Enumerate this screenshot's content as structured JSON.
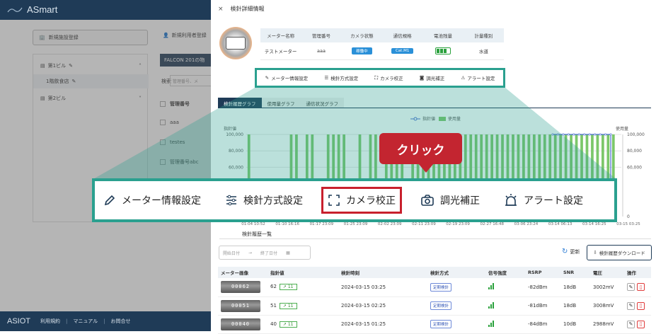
{
  "app": {
    "brand": "ASmart"
  },
  "bg": {
    "register_btn": "新規施設登録",
    "user_btn": "新規利用者登録",
    "tree": [
      {
        "label": "第1ビル"
      },
      {
        "label": "1階飲食店"
      },
      {
        "label": "第2ビル"
      }
    ],
    "facility_tab": "FALCON 201の物",
    "search_label": "検索",
    "search_placeholder": "管理番号、メ",
    "col_header": "管理番号",
    "rows": [
      "aaa",
      "testes",
      "管理番号abc"
    ]
  },
  "footer": {
    "logo": "ASIOT",
    "links": [
      "利用規約",
      "マニュアル",
      "お問合せ"
    ]
  },
  "panel": {
    "close": "×",
    "title": "検針詳細情報",
    "info_headers": [
      "メーター名称",
      "管理番号",
      "カメラ状態",
      "通信規格",
      "電池残量",
      "計量種別"
    ],
    "info_values": {
      "name": "テストメーター",
      "id": "aaa",
      "camera": "稼働中",
      "comm": "Cat.M1",
      "type": "水道"
    },
    "actions": [
      "メーター情報設定",
      "検針方式設定",
      "カメラ校正",
      "調光補正",
      "アラート設定"
    ],
    "tabs": [
      "検針履歴グラフ",
      "使用量グラフ",
      "通信状況グラフ"
    ],
    "history_title": "検針履歴一覧",
    "date_from": "開始日付",
    "date_to": "終了日付",
    "refresh": "更新",
    "download": "検針履歴ダウンロード",
    "table_headers": [
      "メーター画像",
      "指針値",
      "検針時刻",
      "検針方式",
      "信号強度",
      "RSRP",
      "SNR",
      "電圧",
      "操作"
    ],
    "table_rows": [
      {
        "img": "00062",
        "value": "62",
        "delta": "↗ 11",
        "time": "2024-03-15 03:25",
        "method": "定期検針",
        "rsrp": "-82dBm",
        "snr": "18dB",
        "volt": "3002mV"
      },
      {
        "img": "00051",
        "value": "51",
        "delta": "↗ 11",
        "time": "2024-03-15 02:25",
        "method": "定期検針",
        "rsrp": "-81dBm",
        "snr": "18dB",
        "volt": "3008mV"
      },
      {
        "img": "00040",
        "value": "40",
        "delta": "↗ 11",
        "time": "2024-03-15 01:25",
        "method": "定期検針",
        "rsrp": "-84dBm",
        "snr": "10dB",
        "volt": "2988mV"
      }
    ]
  },
  "chart_data": {
    "type": "bar",
    "legend": [
      "指針値",
      "使用量"
    ],
    "ylabel": "指針値",
    "y2label": "使用量",
    "yticks": [
      "100,000",
      "80,000",
      "60,000"
    ],
    "y2ticks": [
      "100,000",
      "80,000",
      "60,000",
      "0"
    ],
    "xticks": [
      "01-04 10:52",
      "01-10 16:16",
      "01-17 23:09",
      "01-25 23:09",
      "02-02 23:09",
      "02-11 23:09",
      "02-19 23:09",
      "02-27 16:48",
      "03-06 23:24",
      "03-14 06:13",
      "03-14 16:25",
      "03-15 03:25"
    ],
    "bars": [
      100000,
      0,
      0,
      0,
      0,
      0,
      0,
      0,
      100000,
      100000,
      0,
      100000,
      100000,
      0,
      0,
      100000,
      100000,
      100000,
      100000,
      0,
      0,
      100000,
      0,
      100000,
      100000,
      0,
      100000,
      100000,
      100000,
      100000,
      0,
      100000,
      100000,
      100000,
      100000,
      100000,
      100000,
      100000,
      100000,
      100000,
      100000,
      100000,
      100000,
      100000,
      100000,
      100000,
      100000,
      100000,
      100000,
      100000,
      100000,
      100000,
      100000,
      100000,
      100000,
      100000,
      100000,
      100000,
      100000,
      100000,
      100000,
      100000,
      100000,
      100000,
      100000,
      100000,
      100000,
      100000,
      100000,
      100000,
      0
    ],
    "line_value": 100000,
    "ylim": [
      0,
      100000
    ]
  },
  "callout": "クリック",
  "colors": {
    "teal": "#2aa08f",
    "navy": "#1f3b57",
    "red": "#c8202d",
    "bar": "#7cc76a",
    "line": "#4a6ed0"
  }
}
